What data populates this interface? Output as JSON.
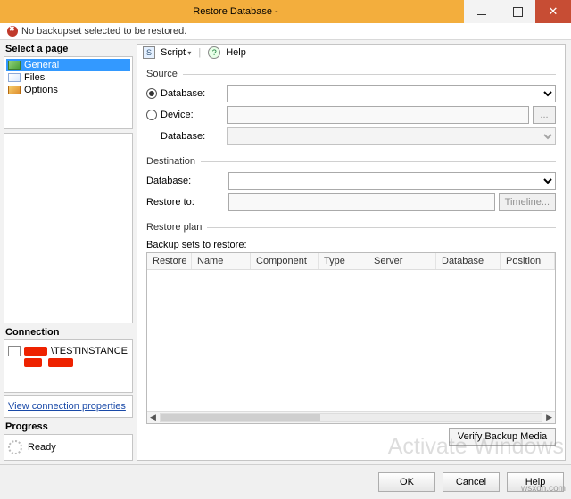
{
  "window": {
    "title": "Restore Database -"
  },
  "warning": {
    "text": "No backupset selected to be restored."
  },
  "sidebar": {
    "title": "Select a page",
    "items": [
      {
        "label": "General",
        "selected": true
      },
      {
        "label": "Files",
        "selected": false
      },
      {
        "label": "Options",
        "selected": false
      }
    ]
  },
  "connection": {
    "title": "Connection",
    "instance": "\\TESTINSTANCE",
    "link": "View connection properties"
  },
  "progress": {
    "title": "Progress",
    "status": "Ready"
  },
  "toolbar": {
    "script": "Script",
    "help": "Help"
  },
  "source": {
    "legend": "Source",
    "db_label": "Database:",
    "dev_label": "Device:",
    "db2_label": "Database:",
    "browse": "...",
    "selected_radio": "database"
  },
  "destination": {
    "legend": "Destination",
    "db_label": "Database:",
    "restore_to_label": "Restore to:",
    "restore_to_value": "",
    "timeline_btn": "Timeline..."
  },
  "restore_plan": {
    "legend": "Restore plan",
    "subhead": "Backup sets to restore:",
    "columns": [
      "Restore",
      "Name",
      "Component",
      "Type",
      "Server",
      "Database",
      "Position"
    ],
    "rows": []
  },
  "buttons": {
    "verify": "Verify Backup Media",
    "ok": "OK",
    "cancel": "Cancel",
    "help": "Help"
  },
  "watermark": "Activate Windows",
  "corner": "wsxdn.com"
}
